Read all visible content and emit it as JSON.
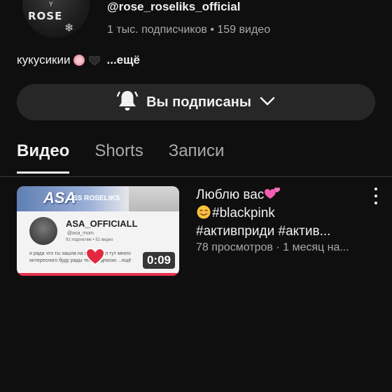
{
  "channel": {
    "avatar_text": "ROSE",
    "avatar_small": "Y",
    "handle": "@rose_roseliks_official",
    "stats": "1 тыс. подписчиков • 159 видео",
    "description": "кукусикии",
    "more": "...ещё"
  },
  "subscribe": {
    "label": "Вы подписаны",
    "icon": "bell-icon",
    "chevron": "chevron-down-icon"
  },
  "tabs": [
    {
      "label": "Видео",
      "active": true
    },
    {
      "label": "Shorts",
      "active": false
    },
    {
      "label": "Записи",
      "active": false
    }
  ],
  "video": {
    "title_line1": "Люблю вас",
    "title_line2": "#blackpink",
    "title_line3": "#активприди #актив...",
    "meta": "78 просмотров · 1 месяц на...",
    "duration": "0:09",
    "progress_fraction": 1.0,
    "thumbnail": {
      "banner_text": "ASA",
      "banner_sub": "SS ROSELIKS",
      "channel_name": "ASA_OFFICIALL",
      "handle": "@asa_mom",
      "meta": "91 подписчик • 51 видео",
      "text": "я рада что ты зашла на мой канал тут много интересного буду рады тебе подписки ...ещё"
    }
  },
  "colors": {
    "background": "#0f0f0f",
    "surface": "#272727",
    "text_primary": "#f1f1f1",
    "text_secondary": "#aaaaaa",
    "progress": "#e7304f"
  }
}
